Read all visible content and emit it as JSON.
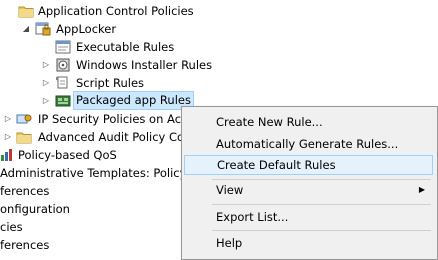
{
  "tree": {
    "items": [
      {
        "label": "Application Control Policies"
      },
      {
        "label": "AppLocker"
      },
      {
        "label": "Executable Rules"
      },
      {
        "label": "Windows Installer Rules"
      },
      {
        "label": "Script Rules"
      },
      {
        "label": "Packaged app Rules"
      },
      {
        "label": "IP Security Policies on Activ"
      },
      {
        "label": "Advanced Audit Policy Cor"
      },
      {
        "label": "Policy-based QoS"
      },
      {
        "label": "Administrative Templates: Policy d"
      },
      {
        "label": "ferences"
      },
      {
        "label": "onfiguration"
      },
      {
        "label": "cies"
      },
      {
        "label": "ferences"
      }
    ]
  },
  "context_menu": {
    "items": [
      {
        "label": "Create New Rule..."
      },
      {
        "label": "Automatically Generate Rules..."
      },
      {
        "label": "Create Default Rules"
      },
      {
        "label": "View"
      },
      {
        "label": "Export List..."
      },
      {
        "label": "Help"
      }
    ]
  },
  "colors": {
    "selection_bg": "#cce8ff",
    "menu_bg": "#f0f0f0",
    "menu_highlight": "#e5f1fb"
  }
}
